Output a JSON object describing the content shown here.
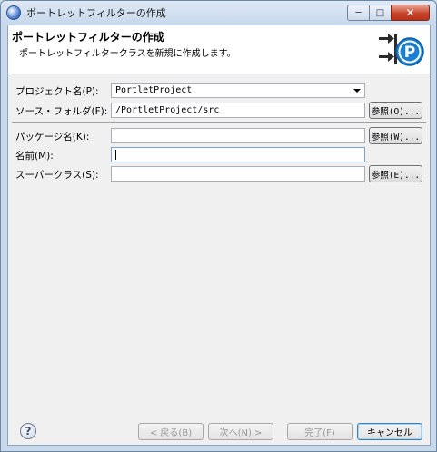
{
  "window": {
    "title": "ポートレットフィルターの作成",
    "controls": {
      "minimize": "─",
      "maximize": "□",
      "close": "✕"
    }
  },
  "banner": {
    "title": "ポートレットフィルターの作成",
    "description": "ポートレットフィルタークラスを新規に作成します。",
    "icon_letter": "P"
  },
  "form": {
    "project": {
      "label": "プロジェクト名(P):",
      "value": "PortletProject"
    },
    "source_folder": {
      "label": "ソース・フォルダ(F):",
      "value": "/PortletProject/src",
      "browse": "参照(O)..."
    },
    "package": {
      "label": "パッケージ名(K):",
      "value": "",
      "browse": "参照(W)..."
    },
    "name": {
      "label": "名前(M):",
      "value": ""
    },
    "superclass": {
      "label": "スーパークラス(S):",
      "value": "",
      "browse": "参照(E)..."
    }
  },
  "footer": {
    "help": "?",
    "back": "< 戻る(B)",
    "next": "次へ(N) >",
    "finish": "完了(F)",
    "cancel": "キャンセル"
  }
}
